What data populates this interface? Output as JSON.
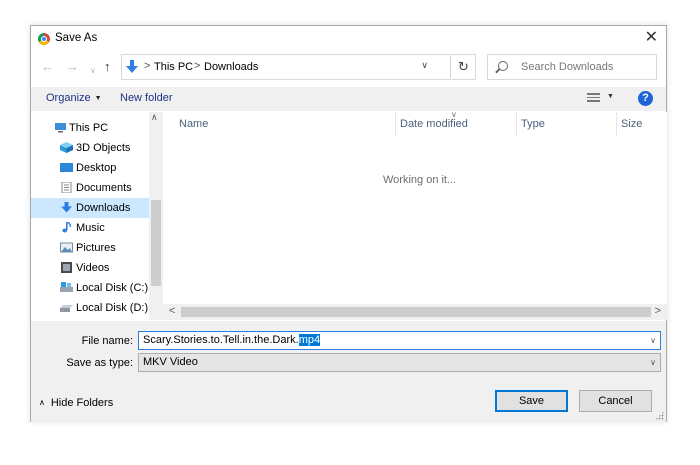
{
  "window": {
    "title": "Save As",
    "close_glyph": "✕"
  },
  "nav": {
    "back_glyph": "←",
    "forward_glyph": "→",
    "recent_glyph": "∨",
    "up_glyph": "↑",
    "breadcrumb": [
      "This PC",
      "Downloads"
    ],
    "separator_glyph": ">",
    "address_dropdown_glyph": "∨",
    "refresh_glyph": "↻",
    "search_placeholder": "Search Downloads"
  },
  "toolbar": {
    "organize_label": "Organize",
    "organize_caret": "▼",
    "new_folder_label": "New folder",
    "view_caret": "▼",
    "help_glyph": "?"
  },
  "sidebar": {
    "items": [
      {
        "label": "This PC",
        "icon": "this-pc-icon"
      },
      {
        "label": "3D Objects",
        "icon": "3d-objects-icon"
      },
      {
        "label": "Desktop",
        "icon": "desktop-icon"
      },
      {
        "label": "Documents",
        "icon": "documents-icon"
      },
      {
        "label": "Downloads",
        "icon": "downloads-icon",
        "selected": true
      },
      {
        "label": "Music",
        "icon": "music-icon"
      },
      {
        "label": "Pictures",
        "icon": "pictures-icon"
      },
      {
        "label": "Videos",
        "icon": "videos-icon"
      },
      {
        "label": "Local Disk (C:)",
        "icon": "local-disk-c-icon"
      },
      {
        "label": "Local Disk (D:)",
        "icon": "local-disk-d-icon"
      }
    ],
    "scroll_up_glyph": "∧"
  },
  "file_list": {
    "columns": [
      "Name",
      "Date modified",
      "Type",
      "Size"
    ],
    "sort_indicator_glyph": "∨",
    "status": "Working on it...",
    "scroll_left_glyph": "<",
    "scroll_right_glyph": ">"
  },
  "form": {
    "file_name_label": "File name:",
    "file_name_base": "Scary.Stories.to.Tell.in.the.Dark.",
    "file_name_selected": "mp4",
    "save_as_type_label": "Save as type:",
    "save_as_type_value": "MKV Video",
    "dropdown_glyph": "∨"
  },
  "footer": {
    "hide_folders_label": "Hide Folders",
    "hide_folders_caret": "∧",
    "save_label": "Save",
    "cancel_label": "Cancel"
  },
  "colors": {
    "accent": "#0078d7",
    "link": "#1e3287",
    "selection_bg": "#cce8ff",
    "help_blue": "#1f64d6"
  }
}
